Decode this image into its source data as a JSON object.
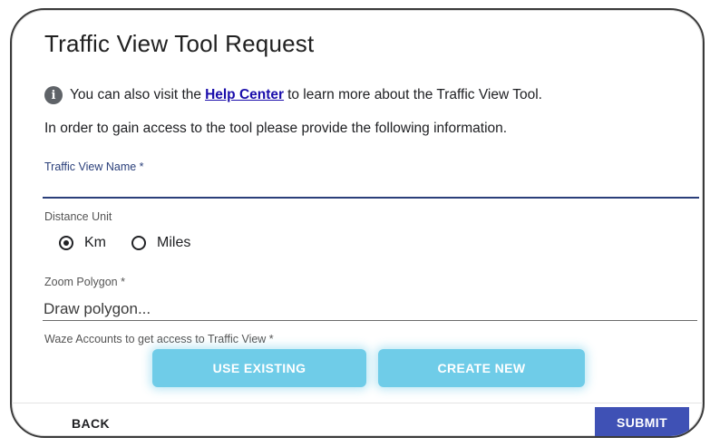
{
  "dialog": {
    "title": "Traffic View Tool Request",
    "info": {
      "icon": "info-icon",
      "prefix": "You can also visit the",
      "link": "Help Center",
      "suffix": "to learn more about the Traffic View Tool."
    },
    "instructions": "In order to gain access to the tool please provide the following information."
  },
  "form": {
    "name_label": "Traffic View Name *",
    "name_value": "",
    "distance_label": "Distance Unit",
    "distance_options": [
      {
        "label": "Km",
        "checked": true
      },
      {
        "label": "Miles",
        "checked": false
      }
    ],
    "zoom_label": "Zoom Polygon *",
    "zoom_placeholder": "Draw polygon...",
    "waze_label": "Waze Accounts to get access to Traffic View *",
    "use_existing": "USE EXISTING",
    "create_new": "CREATE NEW"
  },
  "footer": {
    "back": "BACK",
    "submit": "SUBMIT"
  },
  "colors": {
    "accent": "#3f51b5",
    "light_button": "#6fcce8",
    "link": "#1a0dab"
  }
}
